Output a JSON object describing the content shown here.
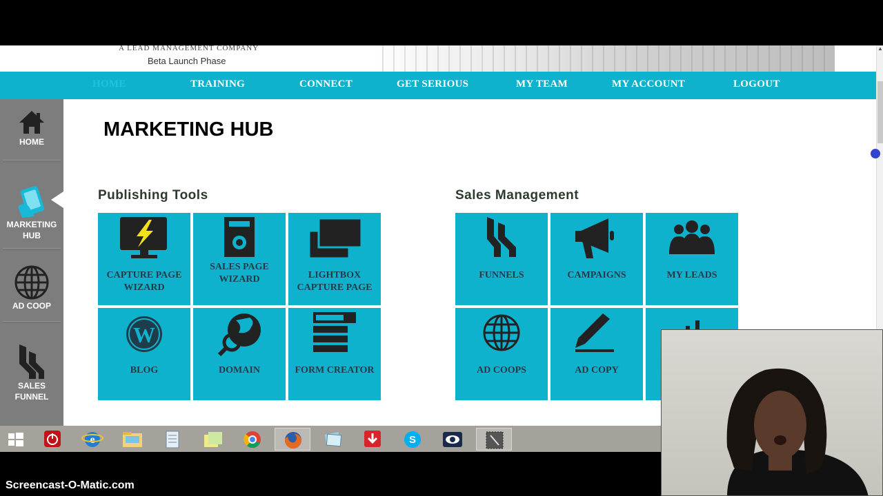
{
  "header": {
    "tagline": "A LEAD MANAGEMENT COMPANY",
    "phase": "Beta Launch Phase"
  },
  "nav": {
    "items": [
      {
        "label": "HOME"
      },
      {
        "label": "TRAINING"
      },
      {
        "label": "CONNECT"
      },
      {
        "label": "GET SERIOUS"
      },
      {
        "label": "MY TEAM"
      },
      {
        "label": "MY ACCOUNT"
      },
      {
        "label": "LOGOUT"
      }
    ],
    "active": "HOME"
  },
  "sidebar": {
    "items": [
      {
        "label_1": "HOME",
        "label_2": "",
        "icon": "home-icon"
      },
      {
        "label_1": "MARKETING",
        "label_2": "HUB",
        "icon": "marketing-hub-icon"
      },
      {
        "label_1": "AD COOP",
        "label_2": "",
        "icon": "globe-icon"
      },
      {
        "label_1": "SALES",
        "label_2": "FUNNEL",
        "icon": "funnel-icon"
      }
    ]
  },
  "page": {
    "title": "MARKETING HUB"
  },
  "publishing_tools": {
    "title": "Publishing Tools",
    "tiles": [
      {
        "line1": "CAPTURE PAGE",
        "line2": "WIZARD",
        "icon": "monitor-lightning-icon"
      },
      {
        "line1": "SALES PAGE",
        "line2": "WIZARD",
        "icon": "page-gear-icon"
      },
      {
        "line1": "LIGHTBOX",
        "line2": "CAPTURE PAGE",
        "icon": "windows-stack-icon"
      },
      {
        "line1": "BLOG",
        "line2": "",
        "icon": "wordpress-icon"
      },
      {
        "line1": "DOMAIN",
        "line2": "",
        "icon": "globe-search-icon"
      },
      {
        "line1": "FORM CREATOR",
        "line2": "",
        "icon": "form-icon"
      }
    ]
  },
  "sales_management": {
    "title": "Sales Management",
    "tiles": [
      {
        "line1": "FUNNELS",
        "icon": "funnel-icon"
      },
      {
        "line1": "CAMPAIGNS",
        "icon": "megaphone-icon"
      },
      {
        "line1": "MY LEADS",
        "icon": "people-icon"
      },
      {
        "line1": "AD COOPS",
        "icon": "globe-icon"
      },
      {
        "line1": "AD COPY",
        "icon": "pencil-icon"
      },
      {
        "line1": "",
        "icon": "chart-icon"
      }
    ]
  },
  "taskbar": {
    "apps": [
      "windows-start-icon",
      "power-icon",
      "internet-explorer-icon",
      "file-explorer-icon",
      "document-icon",
      "sticky-notes-icon",
      "chrome-icon",
      "firefox-icon",
      "screenshot-icon",
      "download-icon",
      "skype-icon",
      "viewer-icon",
      "recorder-icon"
    ]
  },
  "watermark": "Screencast-O-Matic.com",
  "colors": {
    "accent": "#0fb2cc",
    "sidebar": "#7d7d7d",
    "tile_text": "#1f3c4a"
  }
}
